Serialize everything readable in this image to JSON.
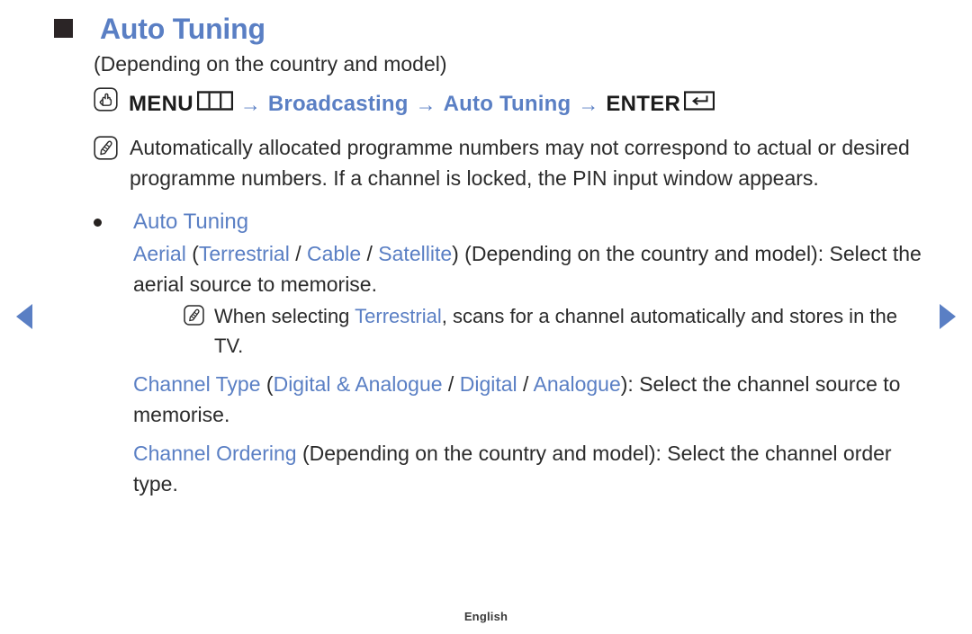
{
  "nav": {
    "prev_icon": "triangle-left-icon",
    "next_icon": "triangle-right-icon",
    "accent_color": "#5a7fc4"
  },
  "header": {
    "marker_icon": "square-bullet-icon",
    "title": "Auto Tuning"
  },
  "subtitle": "(Depending on the country and model)",
  "menu_path": {
    "hand_icon": "hand-press-icon",
    "menu_label": "MENU",
    "menu_keycap_icon": "menu-keycap-icon",
    "arrow": "→",
    "step_broadcasting": "Broadcasting",
    "step_auto_tuning": "Auto Tuning",
    "enter_label": "ENTER",
    "enter_keycap_icon": "enter-keycap-icon"
  },
  "notes": {
    "primary": {
      "icon": "note-pencil-icon",
      "text": "Automatically allocated programme numbers may not correspond to actual or desired programme numbers. If a channel is locked, the PIN input window appears."
    },
    "nested": {
      "icon": "note-pencil-icon",
      "prefix": "When selecting ",
      "highlight": "Terrestrial",
      "suffix": ", scans for a channel automatically and stores in the TV."
    }
  },
  "bullet": {
    "dot_icon": "round-bullet-icon",
    "heading": "Auto Tuning",
    "aerial": {
      "term": "Aerial",
      "open_paren": " (",
      "option_1": "Terrestrial",
      "sep_1": " / ",
      "option_2": "Cable",
      "sep_2": " / ",
      "option_3": "Satellite",
      "close_paren": ")",
      "qualifier": " (Depending on the country and model):",
      "description": "Select the aerial source to memorise."
    },
    "channel_type": {
      "term": "Channel Type",
      "open_paren": " (",
      "option_1": "Digital & Analogue",
      "sep_1": " / ",
      "option_2": "Digital",
      "sep_2": " / ",
      "option_3": "Analogue",
      "close_paren": "):",
      "description": " Select the channel source to memorise."
    },
    "channel_ordering": {
      "term": "Channel Ordering",
      "qualifier": " (Depending on the country and model):",
      "description": " Select the channel order type."
    }
  },
  "footer": {
    "language": "English"
  }
}
